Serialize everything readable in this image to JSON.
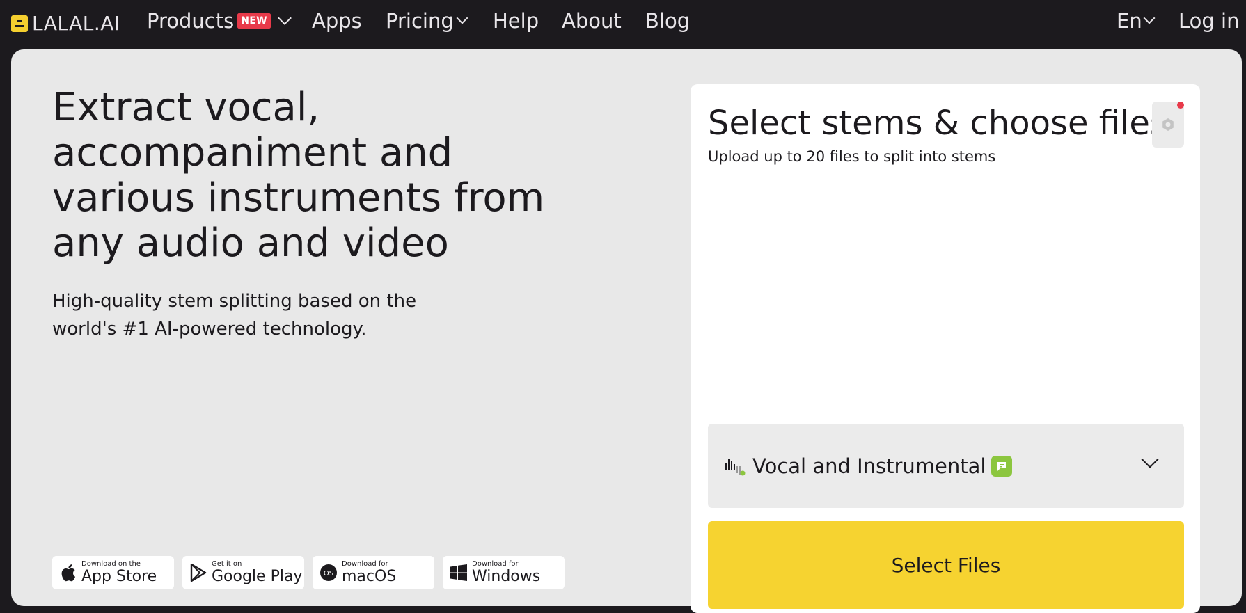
{
  "nav": {
    "logo_text": "LALAL.AI",
    "items": [
      {
        "label": "Products",
        "badge": "NEW"
      },
      {
        "label": "Apps"
      },
      {
        "label": "Pricing"
      },
      {
        "label": "Help"
      },
      {
        "label": "About"
      },
      {
        "label": "Blog"
      }
    ],
    "language": "En",
    "login": "Log in"
  },
  "hero": {
    "title": "Extract vocal, accompaniment and various instruments from any audio and video",
    "subtitle": "High-quality stem splitting based on the world's #1 AI-powered technology."
  },
  "stores": [
    {
      "small": "Download on the",
      "big": "App Store",
      "icon": "apple-icon"
    },
    {
      "small": "Get it on",
      "big": "Google Play",
      "icon": "google-play-icon"
    },
    {
      "small": "Download for",
      "big": "macOS",
      "icon": "macos-icon"
    },
    {
      "small": "Download for",
      "big": "Windows",
      "icon": "windows-icon"
    }
  ],
  "panel": {
    "title": "Select stems & choose files",
    "subtitle": "Upload up to 20 files to split into stems",
    "stem_option": "Vocal and Instrumental",
    "select_files": "Select Files"
  },
  "colors": {
    "nav_bg": "#1c1a1e",
    "main_bg": "#e8e8e8",
    "accent_yellow": "#f6d330",
    "badge_red": "#e83a4a",
    "stem_badge_green": "#8cc63f"
  }
}
